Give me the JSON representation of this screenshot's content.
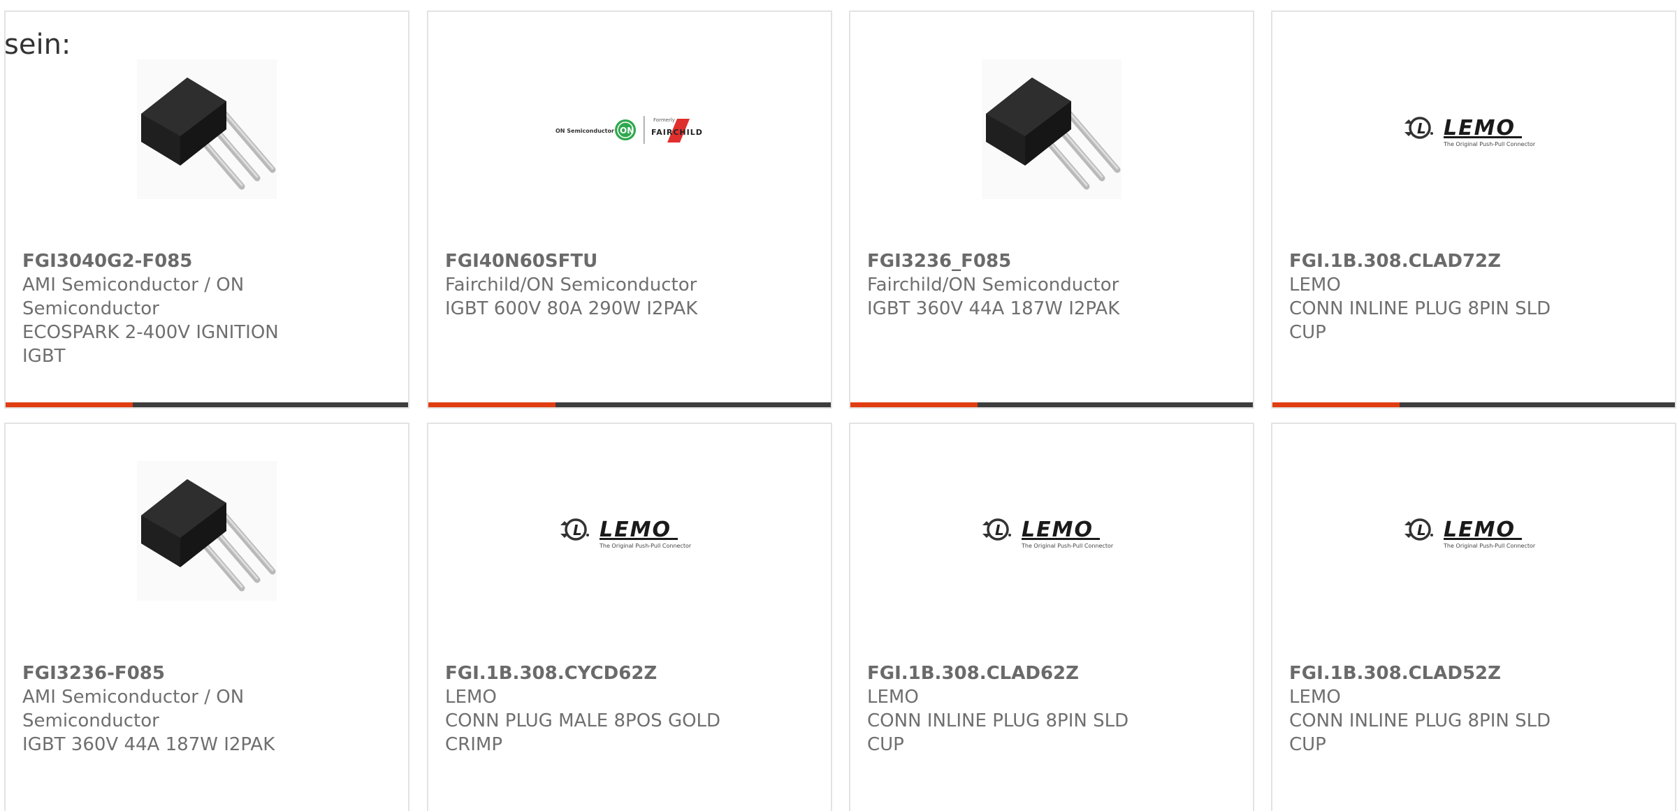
{
  "intro_text": "sein:",
  "colors": {
    "accent": "#e03e12",
    "bar": "#3d3d3d",
    "border": "#e3e3e3",
    "text": "#6f6f6f"
  },
  "products": [
    {
      "part_number": "FGI3040G2-F085",
      "manufacturer": "AMI Semiconductor / ON Semiconductor",
      "description": "ECOSPARK 2-400V IGNITION IGBT",
      "image": "to262-transistor"
    },
    {
      "part_number": "FGI40N60SFTU",
      "manufacturer": "Fairchild/ON Semiconductor",
      "description": "IGBT 600V 80A 290W I2PAK",
      "image": "on-semiconductor-fairchild-logo"
    },
    {
      "part_number": "FGI3236_F085",
      "manufacturer": "Fairchild/ON Semiconductor",
      "description": "IGBT 360V 44A 187W I2PAK",
      "image": "to262-transistor"
    },
    {
      "part_number": "FGI.1B.308.CLAD72Z",
      "manufacturer": "LEMO",
      "description": "CONN INLINE PLUG 8PIN SLD CUP",
      "image": "lemo-logo"
    },
    {
      "part_number": "FGI3236-F085",
      "manufacturer": "AMI Semiconductor / ON Semiconductor",
      "description": "IGBT 360V 44A 187W I2PAK",
      "image": "to262-transistor"
    },
    {
      "part_number": "FGI.1B.308.CYCD62Z",
      "manufacturer": "LEMO",
      "description": "CONN PLUG MALE 8POS GOLD CRIMP",
      "image": "lemo-logo"
    },
    {
      "part_number": "FGI.1B.308.CLAD62Z",
      "manufacturer": "LEMO",
      "description": "CONN INLINE PLUG 8PIN SLD CUP",
      "image": "lemo-logo"
    },
    {
      "part_number": "FGI.1B.308.CLAD52Z",
      "manufacturer": "LEMO",
      "description": "CONN INLINE PLUG 8PIN SLD CUP",
      "image": "lemo-logo"
    }
  ],
  "logos": {
    "on_semi_text": "ON Semiconductor",
    "on_badge": "ON",
    "formerly": "Formerly",
    "fairchild": "FAIRCHILD",
    "lemo": "LEMO",
    "lemo_tagline": "The Original Push-Pull Connector"
  }
}
